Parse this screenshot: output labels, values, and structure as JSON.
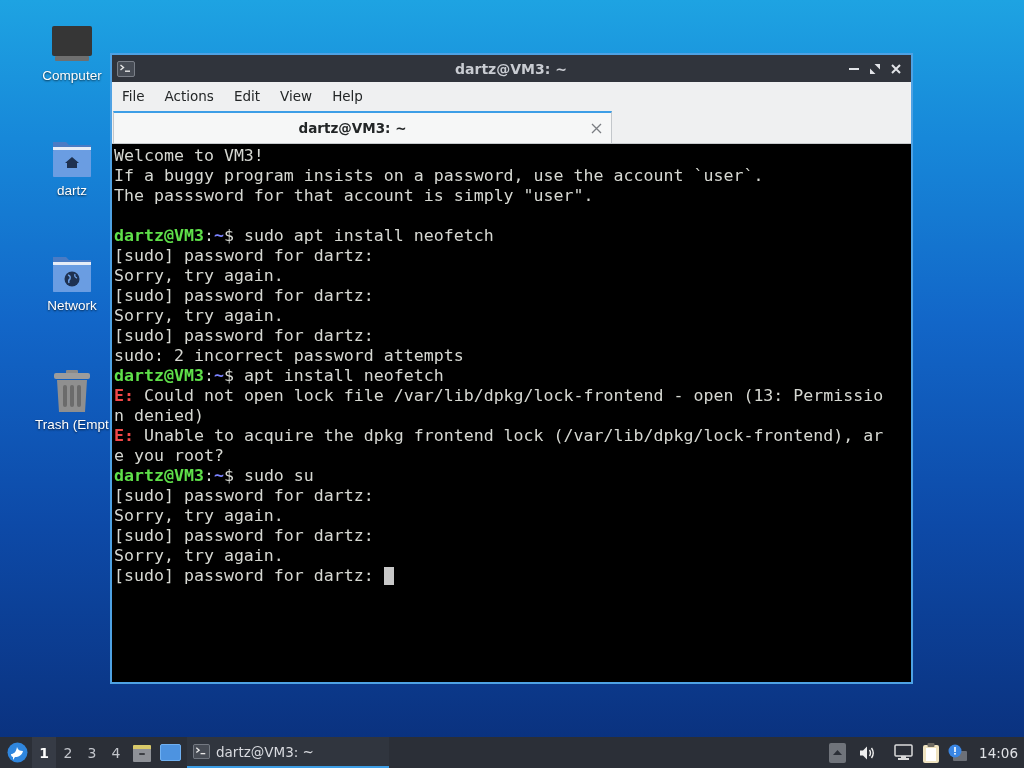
{
  "desktop": {
    "icons": [
      {
        "kind": "computer",
        "label": "Computer"
      },
      {
        "kind": "home",
        "label": "dartz"
      },
      {
        "kind": "network",
        "label": "Network"
      },
      {
        "kind": "trash",
        "label": "Trash (Empt"
      }
    ]
  },
  "window": {
    "title": "dartz@VM3: ~",
    "menu": [
      "File",
      "Actions",
      "Edit",
      "View",
      "Help"
    ],
    "tabs": [
      {
        "label": "dartz@VM3: ~",
        "selected": true
      }
    ],
    "terminal": {
      "cursor_visible": true,
      "lines": [
        {
          "kind": "output",
          "text": "Welcome to VM3!"
        },
        {
          "kind": "output",
          "text": "If a buggy program insists on a password, use the account `user`."
        },
        {
          "kind": "output",
          "text": "The passsword for that account is simply \"user\"."
        },
        {
          "kind": "blank"
        },
        {
          "kind": "prompt",
          "user_host": "dartz@VM3",
          "separator": ":",
          "path": "~",
          "symbol": "$",
          "command": "sudo apt install neofetch"
        },
        {
          "kind": "output",
          "text": "[sudo] password for dartz:"
        },
        {
          "kind": "output",
          "text": "Sorry, try again."
        },
        {
          "kind": "output",
          "text": "[sudo] password for dartz:"
        },
        {
          "kind": "output",
          "text": "Sorry, try again."
        },
        {
          "kind": "output",
          "text": "[sudo] password for dartz:"
        },
        {
          "kind": "output",
          "text": "sudo: 2 incorrect password attempts"
        },
        {
          "kind": "prompt",
          "user_host": "dartz@VM3",
          "separator": ":",
          "path": "~",
          "symbol": "$",
          "command": "apt install neofetch"
        },
        {
          "kind": "error",
          "prefix": "E:",
          "text": "Could not open lock file /var/lib/dpkg/lock-frontend - open (13: Permissio"
        },
        {
          "kind": "output",
          "text": "n denied)"
        },
        {
          "kind": "error",
          "prefix": "E:",
          "text": "Unable to acquire the dpkg frontend lock (/var/lib/dpkg/lock-frontend), ar"
        },
        {
          "kind": "output",
          "text": "e you root?"
        },
        {
          "kind": "prompt",
          "user_host": "dartz@VM3",
          "separator": ":",
          "path": "~",
          "symbol": "$",
          "command": "sudo su"
        },
        {
          "kind": "output",
          "text": "[sudo] password for dartz:"
        },
        {
          "kind": "output",
          "text": "Sorry, try again."
        },
        {
          "kind": "output",
          "text": "[sudo] password for dartz:"
        },
        {
          "kind": "output",
          "text": "Sorry, try again."
        },
        {
          "kind": "output",
          "text": "[sudo] password for dartz:"
        }
      ]
    }
  },
  "taskbar": {
    "workspaces": [
      {
        "label": "1",
        "selected": true
      },
      {
        "label": "2",
        "selected": false
      },
      {
        "label": "3",
        "selected": false
      },
      {
        "label": "4",
        "selected": false
      }
    ],
    "tasks": [
      {
        "label": "dartz@VM3: ~",
        "selected": true
      }
    ],
    "clock": "14:06"
  }
}
